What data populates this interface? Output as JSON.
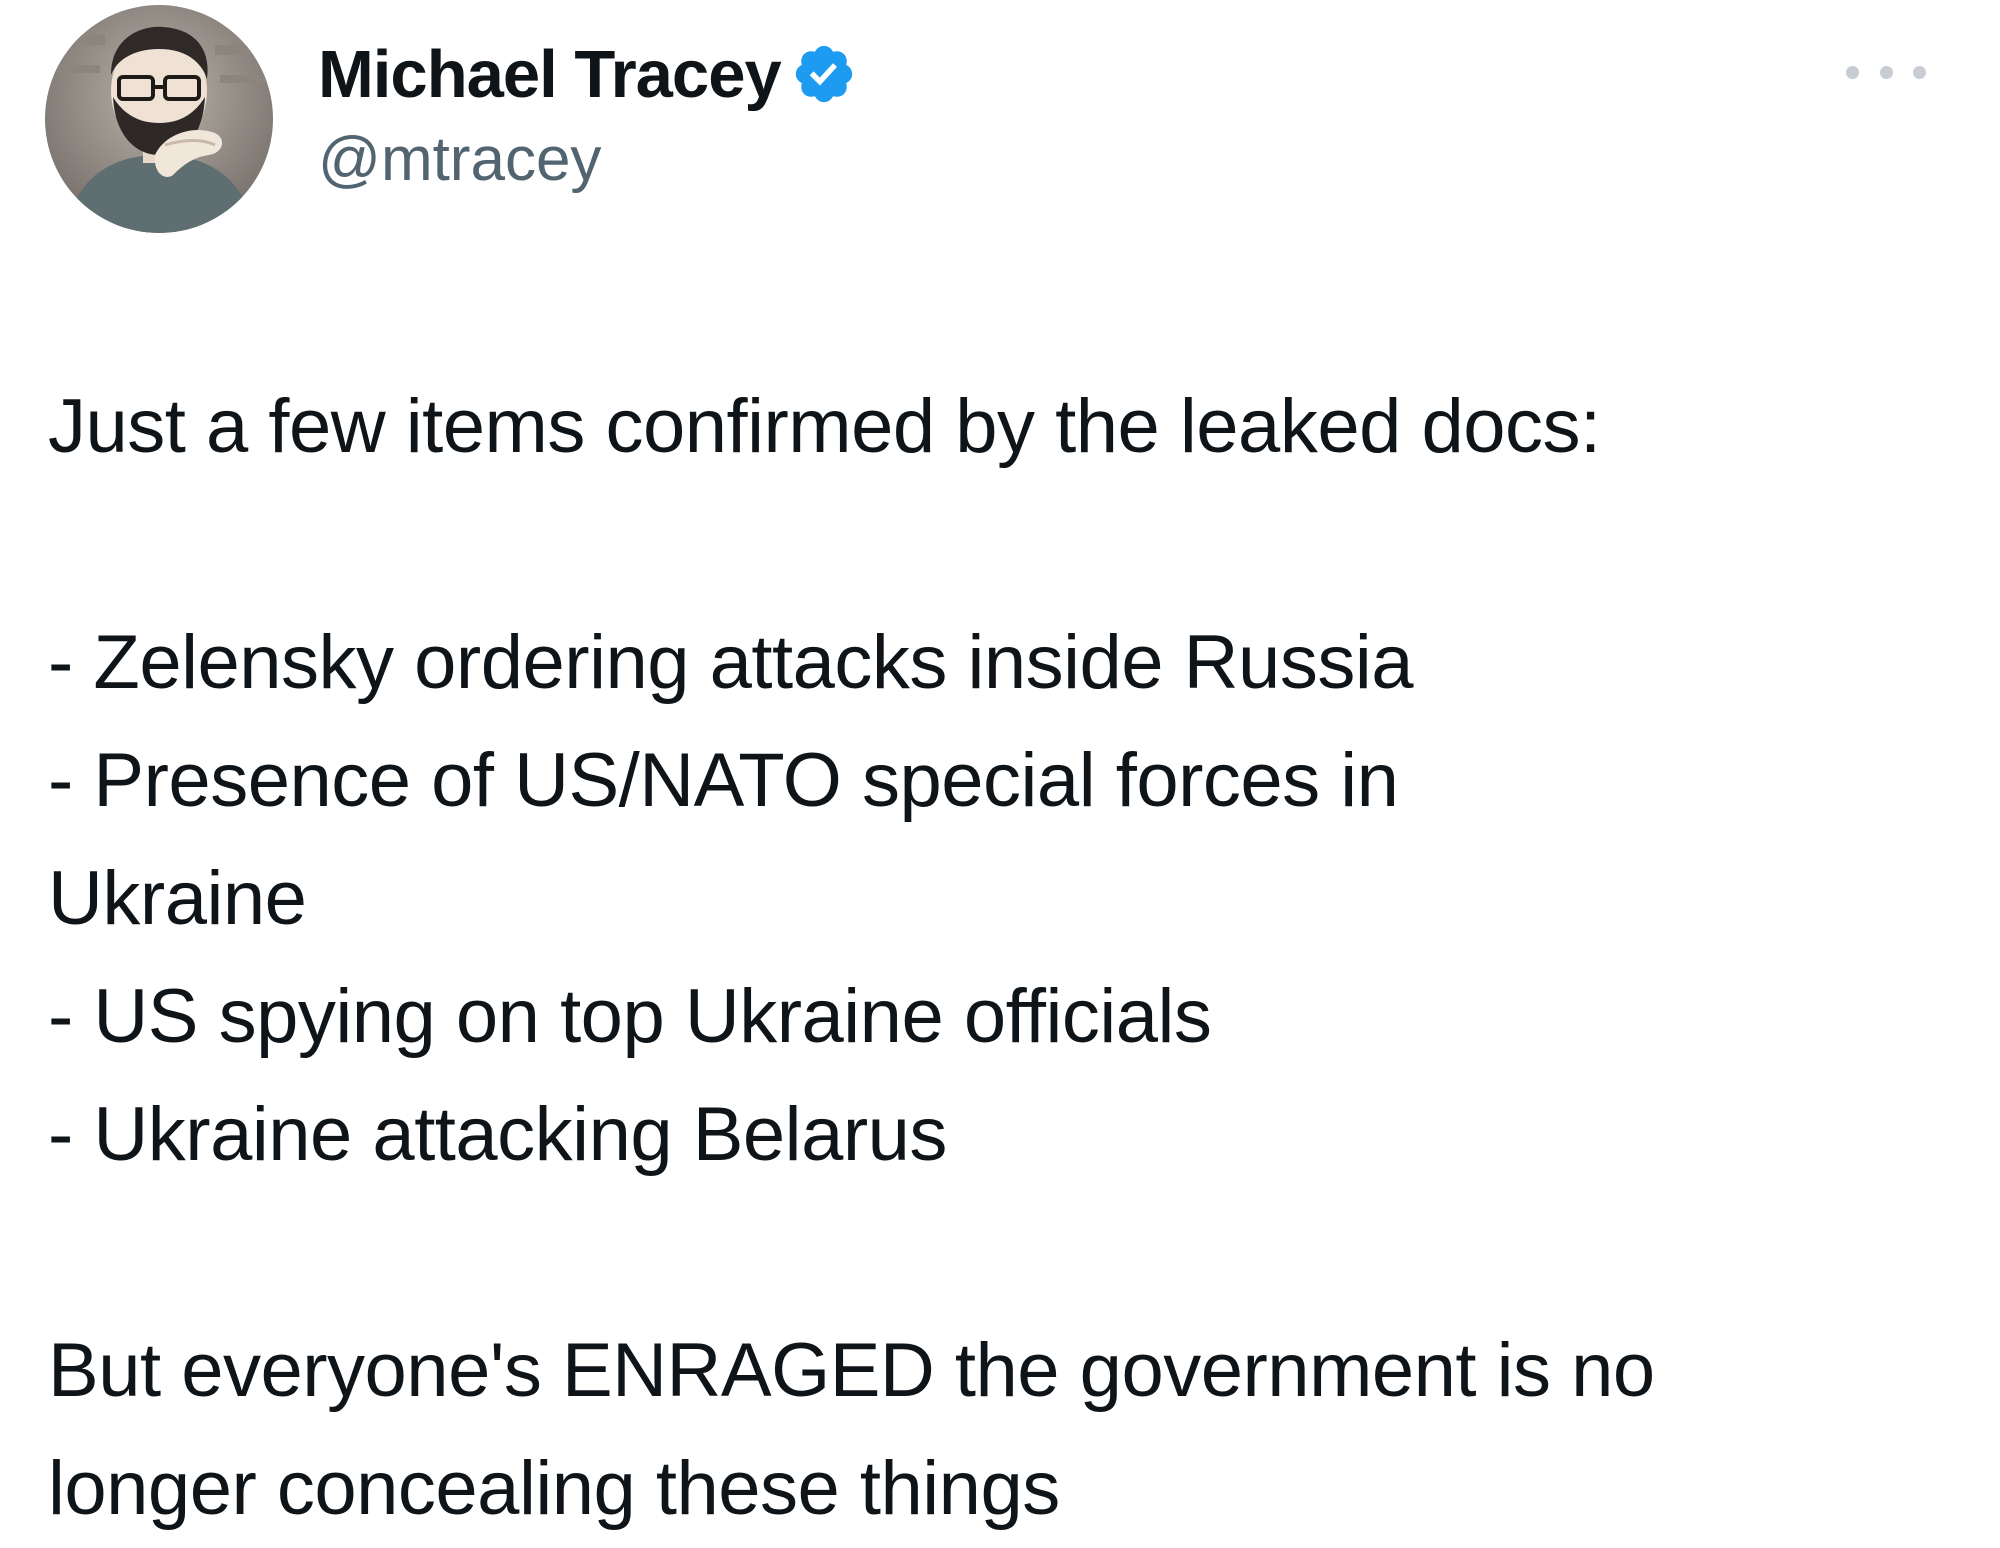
{
  "author": {
    "display_name": "Michael Tracey",
    "handle": "@mtracey",
    "verified": true,
    "avatar_icon": "profile-photo-avatar"
  },
  "menu": {
    "more_icon": "more-horizontal-icon"
  },
  "tweet": {
    "intro": "Just a few items confirmed by the leaked docs:",
    "items": [
      "- Zelensky ordering attacks inside Russia",
      "- Presence of US/NATO special forces in\nUkraine",
      "- US spying on top Ukraine officials",
      "- Ukraine attacking Belarus"
    ],
    "closing": "But everyone's ENRAGED the government is no\nlonger concealing these things"
  },
  "colors": {
    "text": "#0f1419",
    "secondary": "#536471",
    "verified": "#1d9bf0"
  }
}
